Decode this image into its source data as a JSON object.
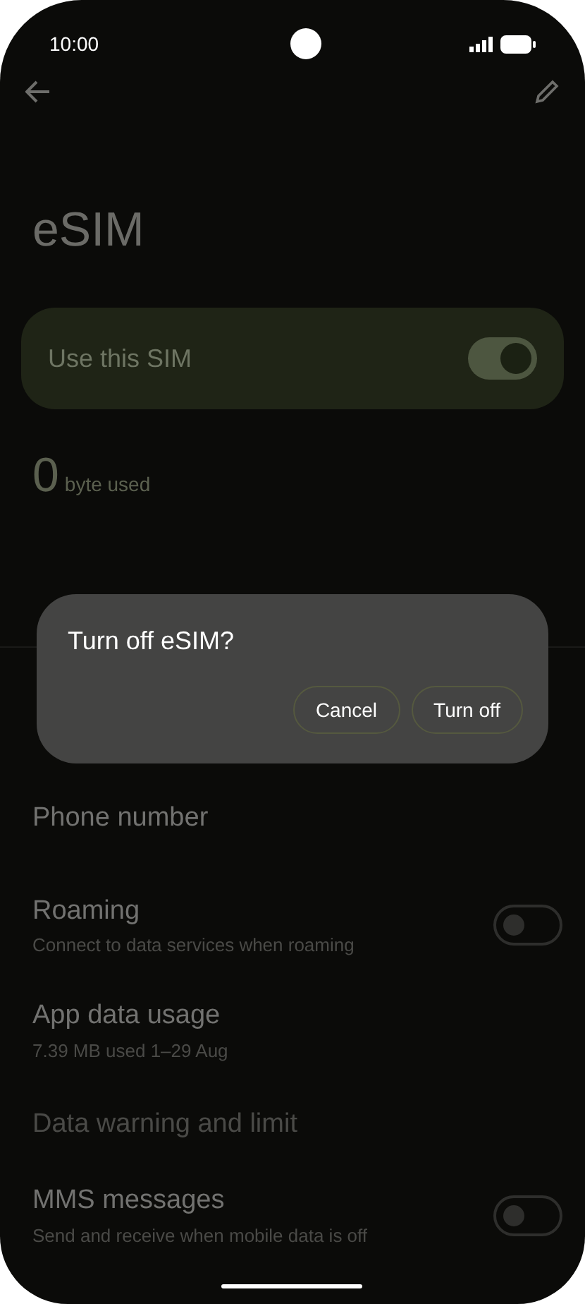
{
  "status_bar": {
    "time": "10:00"
  },
  "title": "eSIM",
  "use_sim": {
    "label": "Use this SIM",
    "on": true
  },
  "usage": {
    "amount": "0",
    "unit": "byte used"
  },
  "settings": [
    {
      "title": "Phone number",
      "disabled": false
    },
    {
      "title": "Roaming",
      "subtitle": "Connect to data services when roaming",
      "toggle": {
        "on": false
      },
      "disabled": false
    },
    {
      "title": "App data usage",
      "subtitle": "7.39 MB used 1–29 Aug",
      "disabled": false
    },
    {
      "title": "Data warning and limit",
      "disabled": true
    },
    {
      "title": "MMS messages",
      "subtitle": "Send and receive when mobile data is off",
      "toggle": {
        "on": false
      },
      "disabled": false
    }
  ],
  "dialog": {
    "title": "Turn off eSIM?",
    "buttons": [
      "Cancel",
      "Turn off"
    ]
  }
}
